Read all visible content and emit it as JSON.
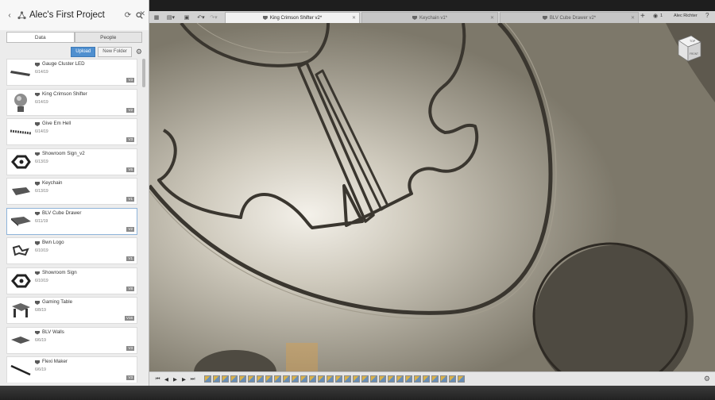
{
  "panel": {
    "title": "Alec's First Project",
    "tabs": [
      {
        "label": "Data",
        "active": true
      },
      {
        "label": "People",
        "active": false
      }
    ],
    "upload_label": "Upload",
    "new_folder_label": "New Folder",
    "items": [
      {
        "name": "Gauge Cluster LED",
        "date": "6/14/19",
        "version": "V3",
        "thumb": "bar"
      },
      {
        "name": "King Crimson Shifter",
        "date": "6/14/19",
        "version": "V2",
        "thumb": "ball"
      },
      {
        "name": "Give Em Hell",
        "date": "6/14/19",
        "version": "V3",
        "thumb": "text"
      },
      {
        "name": "Showroom Sign_v2",
        "date": "6/13/19",
        "version": "V6",
        "thumb": "sign"
      },
      {
        "name": "Keychain",
        "date": "6/13/19",
        "version": "V1",
        "thumb": "key"
      },
      {
        "name": "BLV Cube Drawer",
        "date": "6/11/19",
        "version": "V2",
        "thumb": "drawer",
        "selected": true
      },
      {
        "name": "Bwn Logo",
        "date": "6/10/19",
        "version": "V1",
        "thumb": "logo"
      },
      {
        "name": "Showroom Sign",
        "date": "6/10/19",
        "version": "V8",
        "thumb": "sign"
      },
      {
        "name": "Gaming Table",
        "date": "6/8/19",
        "version": "V16",
        "thumb": "table"
      },
      {
        "name": "BLV Walls",
        "date": "6/6/19",
        "version": "V3",
        "thumb": "walls"
      },
      {
        "name": "Flexi Maker",
        "date": "6/6/19",
        "version": "V3",
        "thumb": "rod"
      }
    ]
  },
  "topbar": {
    "tabs": [
      {
        "label": "King Crimson Shifter v2*",
        "active": true
      },
      {
        "label": "Keychain v1*",
        "active": false
      },
      {
        "label": "BLV Cube Drawer v2*",
        "active": false
      }
    ],
    "job_count": "1",
    "user": "Alec Richter"
  },
  "viewcube": {
    "top": "TOP",
    "front": "FRONT"
  },
  "colors": {
    "accent": "#4f8fcf",
    "canvas": "#8a8576",
    "engrave": "#3a362f"
  },
  "icons": {
    "back": "chevron-left-icon",
    "hub": "hub-icon",
    "refresh": "refresh-icon",
    "search": "search-icon",
    "close": "close-icon",
    "settings": "gear-icon",
    "grid": "grid-icon",
    "file": "file-icon",
    "save": "save-icon",
    "undo": "undo-icon",
    "redo": "redo-icon",
    "add_tab": "plus-icon",
    "jobs": "jobs-icon",
    "help": "help-icon"
  }
}
